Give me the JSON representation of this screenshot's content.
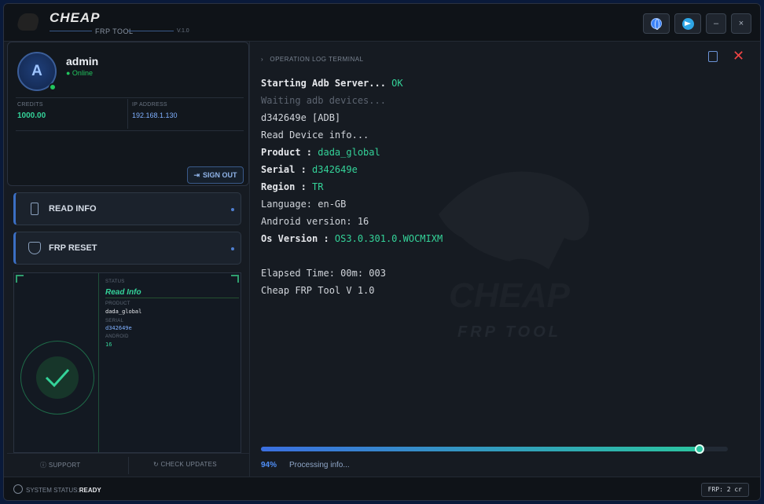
{
  "app": {
    "brand": "CHEAP",
    "subtitle": "FRP TOOL",
    "version": "V.1.0"
  },
  "titlebar": {
    "language_icon": "globe-icon",
    "telegram_icon": "telegram-icon",
    "minimize_label": "–",
    "close_label": "×"
  },
  "user": {
    "avatar_letter": "A",
    "name": "admin",
    "status": "● Online",
    "credits_label": "CREDITS",
    "credits_value": "1000.00",
    "ip_label": "IP ADDRESS",
    "ip_value": "192.168.1.130",
    "signout_label": "SIGN OUT"
  },
  "actions": [
    {
      "label": "READ INFO",
      "icon": "phone-icon"
    },
    {
      "label": "FRP RESET",
      "icon": "shield-icon"
    }
  ],
  "status_panel": {
    "status_label": "STATUS",
    "status_value": "Read Info",
    "product_label": "PRODUCT",
    "product_value": "dada_global",
    "serial_label": "SERIAL",
    "serial_value": "d342649e",
    "android_label": "ANDROID",
    "android_value": "16"
  },
  "footer": {
    "support_label": "SUPPORT",
    "updates_label": "CHECK UPDATES",
    "system_status_label": "SYSTEM STATUS:",
    "system_status_value": "READY",
    "frp_badge": "FRP: 2 cr"
  },
  "terminal": {
    "header": "OPERATION LOG TERMINAL",
    "lines": [
      {
        "text": "Starting Adb Server... ",
        "value": "OK"
      },
      {
        "text": "Waiting adb devices...",
        "value": ""
      },
      {
        "text": "d342649e [ADB]",
        "value": ""
      },
      {
        "text": "Read Device info...",
        "value": ""
      },
      {
        "text": "Product : ",
        "value": "dada_global"
      },
      {
        "text": "Serial : ",
        "value": "d342649e"
      },
      {
        "text": "Region : ",
        "value": "TR"
      },
      {
        "text": "Language: en-GB",
        "value": ""
      },
      {
        "text": "Android version: 16",
        "value": ""
      },
      {
        "text": "Os Version : ",
        "value": "OS3.0.301.0.WOCMIXM"
      },
      {
        "text": "Elapsed Time: 00m: 003",
        "value": ""
      },
      {
        "text": "Cheap FRP Tool V 1.0",
        "value": ""
      }
    ],
    "watermark_title": "CHEAP",
    "watermark_sub": "FRP TOOL"
  },
  "progress": {
    "percent": 94,
    "percent_label": "94%",
    "text": "Processing info..."
  },
  "colors": {
    "accent": "#3b82f6",
    "success": "#34d399",
    "danger": "#ef4444"
  }
}
